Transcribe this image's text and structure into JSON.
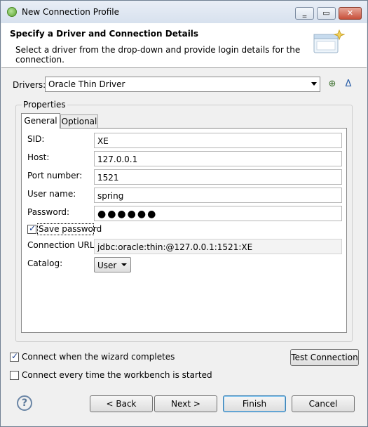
{
  "window": {
    "title": "New Connection Profile"
  },
  "header": {
    "title": "Specify a Driver and Connection Details",
    "description": "Select a driver from the drop-down and provide login details for the connection."
  },
  "drivers": {
    "label": "Drivers:",
    "selected": "Oracle Thin Driver"
  },
  "properties": {
    "group_label": "Properties",
    "tabs": [
      {
        "label": "General"
      },
      {
        "label": "Optional"
      }
    ],
    "fields": {
      "sid": {
        "label": "SID:",
        "value": "XE"
      },
      "host": {
        "label": "Host:",
        "value": "127.0.0.1"
      },
      "port": {
        "label": "Port number:",
        "value": "1521"
      },
      "user": {
        "label": "User name:",
        "value": "spring"
      },
      "password": {
        "label": "Password:",
        "value": "●●●●●●"
      },
      "save_password": {
        "label": "Save password",
        "checked": true
      },
      "url": {
        "label": "Connection URL:",
        "value": "jdbc:oracle:thin:@127.0.0.1:1521:XE"
      },
      "catalog": {
        "label": "Catalog:",
        "value": "User"
      }
    }
  },
  "options": {
    "connect_on_finish": {
      "label": "Connect when the wizard completes",
      "checked": true
    },
    "connect_on_startup": {
      "label": "Connect every time the workbench is started",
      "checked": false
    }
  },
  "buttons": {
    "test_connection": "Test Connection",
    "back": "< Back",
    "next": "Next >",
    "finish": "Finish",
    "cancel": "Cancel"
  },
  "colors": {
    "accent": "#3c7fb1",
    "checkmark": "#1a3e8c"
  }
}
